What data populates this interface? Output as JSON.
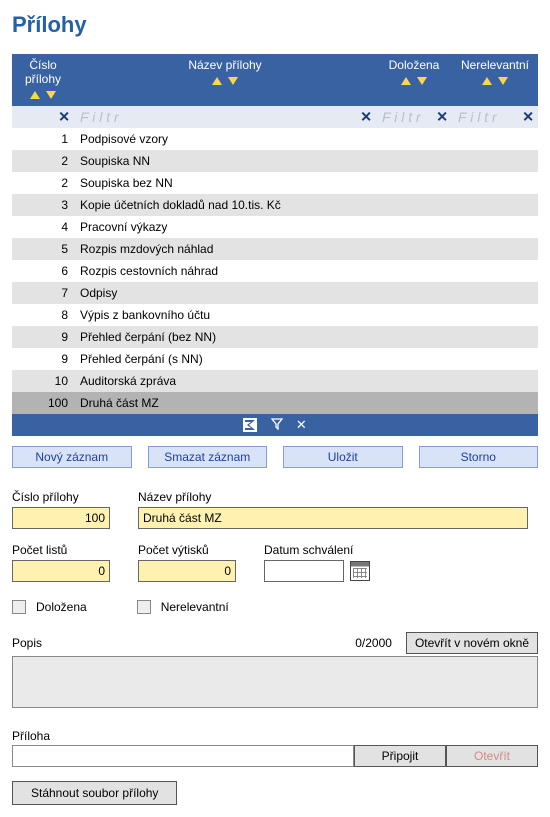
{
  "title": "Přílohy",
  "columns": {
    "cislo": "Číslo přílohy",
    "nazev": "Název přílohy",
    "dolozena": "Doložena",
    "nerelevantni": "Nerelevantní"
  },
  "filter_placeholder": "F i l t r",
  "clear_label": "✕",
  "rows": [
    {
      "num": "1",
      "name": "Podpisové vzory"
    },
    {
      "num": "2",
      "name": "Soupiska NN"
    },
    {
      "num": "2",
      "name": "Soupiska bez NN"
    },
    {
      "num": "3",
      "name": "Kopie účetních dokladů nad 10.tis. Kč"
    },
    {
      "num": "4",
      "name": "Pracovní výkazy"
    },
    {
      "num": "5",
      "name": "Rozpis mzdových náhlad"
    },
    {
      "num": "6",
      "name": "Rozpis cestovních náhrad"
    },
    {
      "num": "7",
      "name": "Odpisy"
    },
    {
      "num": "8",
      "name": "Výpis z bankovního účtu"
    },
    {
      "num": "9",
      "name": "Přehled čerpání (bez NN)"
    },
    {
      "num": "9",
      "name": "Přehled čerpání (s NN)"
    },
    {
      "num": "10",
      "name": "Auditorská zpráva"
    },
    {
      "num": "100",
      "name": "Druhá část MZ",
      "selected": true
    }
  ],
  "actions": {
    "new": "Nový záznam",
    "delete": "Smazat záznam",
    "save": "Uložit",
    "cancel": "Storno"
  },
  "form": {
    "cislo_label": "Číslo přílohy",
    "cislo_value": "100",
    "nazev_label": "Název přílohy",
    "nazev_value": "Druhá část MZ",
    "pocet_listu_label": "Počet listů",
    "pocet_listu_value": "0",
    "pocet_vytisku_label": "Počet výtisků",
    "pocet_vytisku_value": "0",
    "datum_label": "Datum schválení",
    "datum_value": "",
    "dolozena_label": "Doložena",
    "nerelevantni_label": "Nerelevantní",
    "popis_label": "Popis",
    "popis_count": "0/2000",
    "open_new_window": "Otevřít v novém okně",
    "priloha_label": "Příloha",
    "attach": "Připojit",
    "open": "Otevřít",
    "download": "Stáhnout soubor přílohy"
  }
}
